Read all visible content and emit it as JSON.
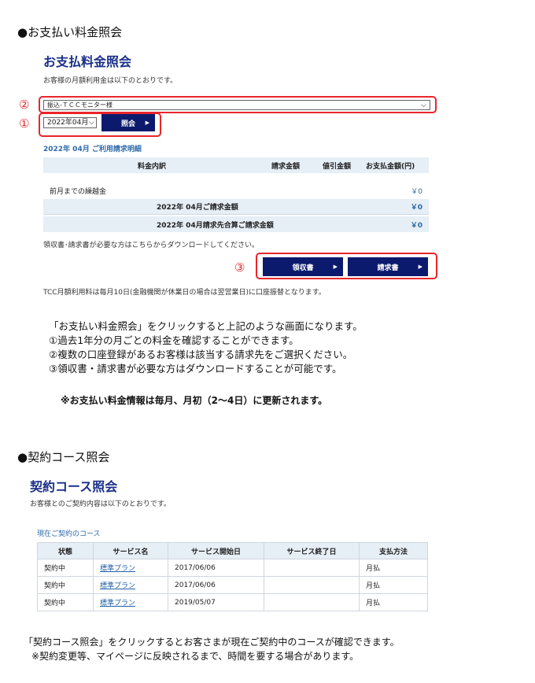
{
  "section1": {
    "heading": "●お支払い料金照会",
    "title": "お支払料金照会",
    "subtitle": "お客様の月額利用金は以下のとおりです。",
    "marker1": "①",
    "marker2": "②",
    "marker3": "③",
    "account_select": "振込-ＴＣＣモニター様",
    "month_select": "2022年04月",
    "inquiry_button": "照会",
    "detail_label": "2022年 04月 ご利用請求明細",
    "table_headers": [
      "料金内訳",
      "請求金額",
      "値引金額",
      "お支払金額(円)"
    ],
    "rows": [
      {
        "label": "前月までの繰越金",
        "value": "￥0"
      },
      {
        "label": "2022年 04月ご請求金額",
        "value": "￥0"
      },
      {
        "label": "2022年 04月請求先合算ご請求金額",
        "value": "￥0"
      }
    ],
    "download_note": "領収書･請求書が必要な方はこちらからダウンロードしてください。",
    "receipt_button": "領収書",
    "invoice_button": "請求書",
    "debit_note": "TCC月額利用料は毎月10日(金融機関が休業日の場合は翌営業日)に口座振替となります。",
    "explain": [
      "「お支払い料金照会」をクリックすると上記のような画面になります。",
      "①過去1年分の月ごとの料金を確認することができます。",
      "②複数の口座登録があるお客様は該当する請求先をご選択ください。",
      "③領収書・請求書が必要な方はダウンロードすることが可能です。"
    ],
    "update_note": "※お支払い料金情報は毎月、月初（2～4日）に更新されます。"
  },
  "section2": {
    "heading": "●契約コース照会",
    "title": "契約コース照会",
    "subtitle": "お客様とのご契約内容は以下のとおりです。",
    "current_label": "現在ご契約のコース",
    "headers": [
      "状態",
      "サービス名",
      "サービス開始日",
      "サービス終了日",
      "支払方法"
    ],
    "rows": [
      {
        "status": "契約中",
        "service": "標準プラン",
        "start": "2017/06/06",
        "end": "",
        "payment": "月払"
      },
      {
        "status": "契約中",
        "service": "標準プラン",
        "start": "2017/06/06",
        "end": "",
        "payment": "月払"
      },
      {
        "status": "契約中",
        "service": "標準プラン",
        "start": "2019/05/07",
        "end": "",
        "payment": "月払"
      }
    ],
    "explain1": "「契約コース照会」をクリックするとお客さまが現在ご契約中のコースが確認できます。",
    "explain2": "※契約変更等、マイページに反映されるまで、時間を要する場合があります。"
  }
}
